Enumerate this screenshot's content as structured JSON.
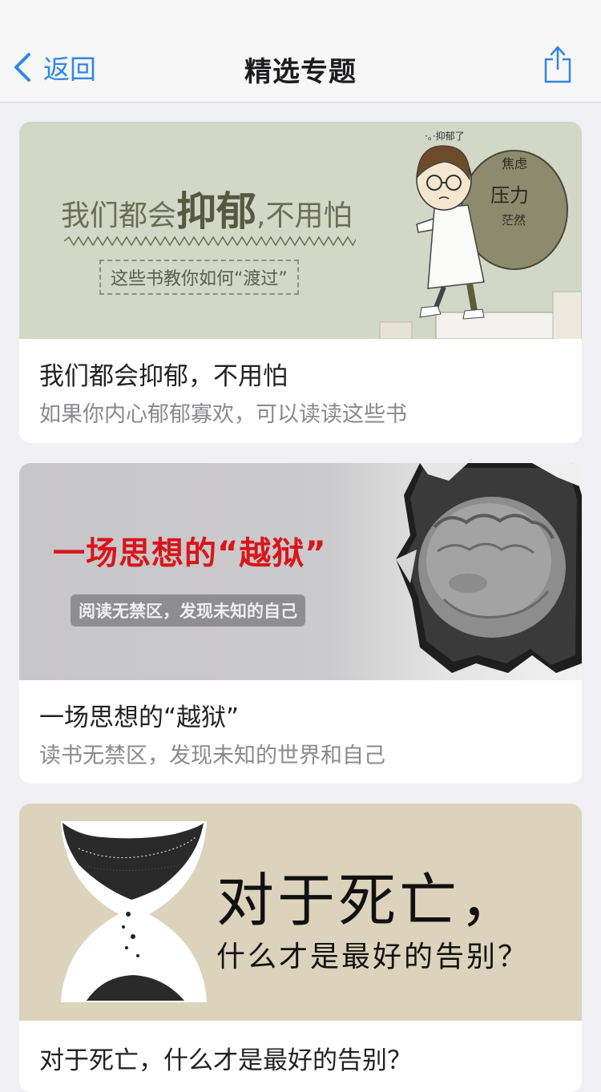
{
  "nav": {
    "back_label": "返回",
    "title": "精选专题",
    "back_icon": "chevron-left-icon",
    "share_icon": "share-icon"
  },
  "colors": {
    "accent": "#2f86e6",
    "background": "#efeff4",
    "card": "#ffffff",
    "banner_red": "#d9151b"
  },
  "topics": [
    {
      "title": "我们都会抑郁，不用怕",
      "description": "如果你内心郁郁寡欢，可以读读这些书",
      "banner": {
        "headline_a": "我们都会",
        "headline_big": "抑郁",
        "headline_b": ",不用怕",
        "sub": "这些书教你如何“渡过”",
        "sack_words": [
          "焦虑",
          "压力",
          "茫然"
        ],
        "doodle": "·。·抑郁了"
      }
    },
    {
      "title": "一场思想的“越狱”",
      "description": "读书无禁区，发现未知的世界和自己",
      "banner": {
        "headline": "一场思想的“越狱”",
        "sub": "阅读无禁区，发现未知的自己"
      }
    },
    {
      "title": "对于死亡，什么才是最好的告别？",
      "description": "",
      "banner": {
        "line1": "对于死亡，",
        "line2": "什么才是最好的告别？"
      }
    }
  ]
}
